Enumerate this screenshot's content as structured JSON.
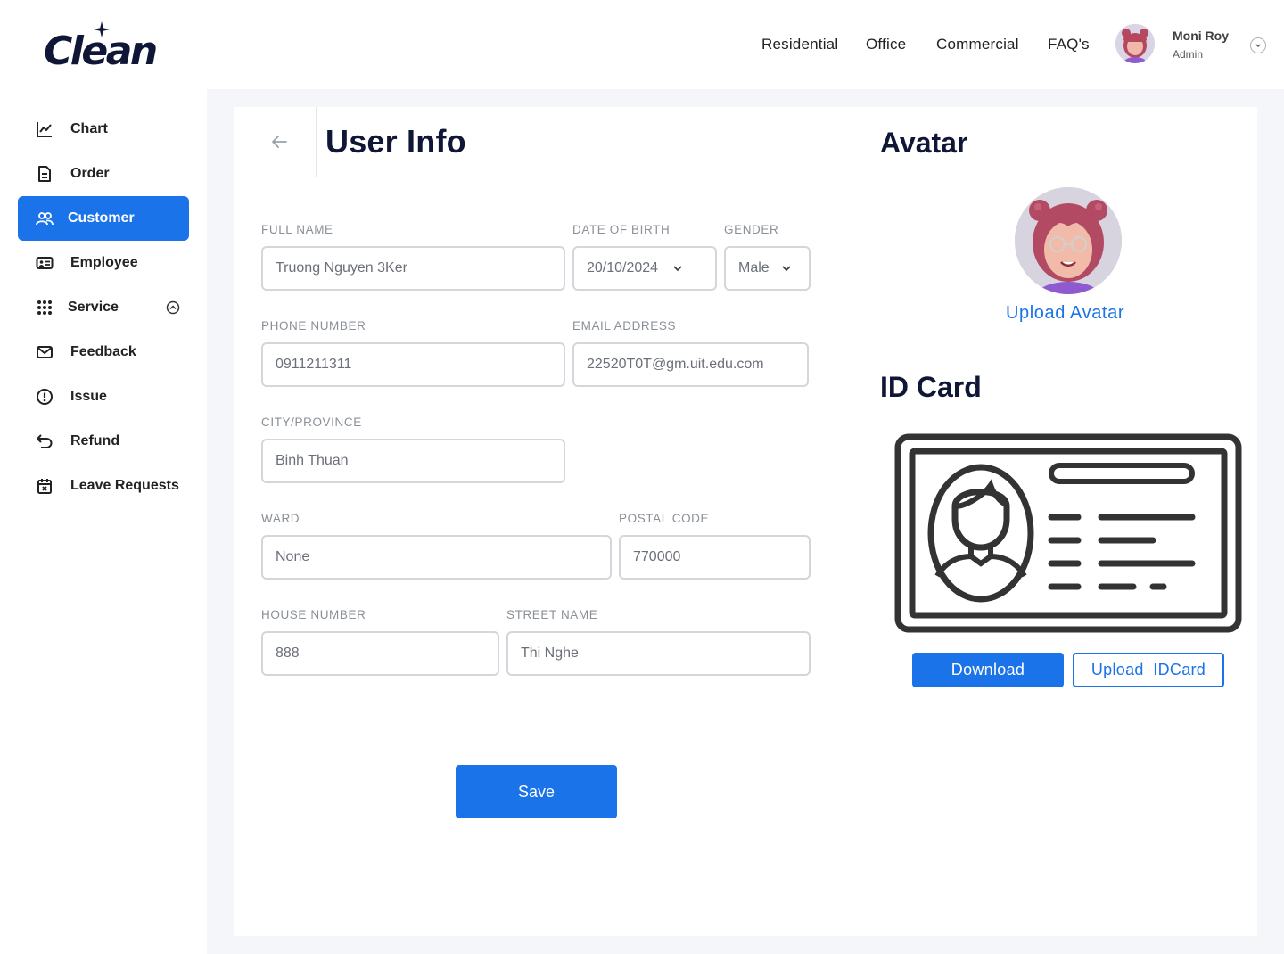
{
  "brand": {
    "logo_text": "Clean",
    "accent_color": "#1a73e8",
    "dark_color": "#0f1636"
  },
  "nav": {
    "residential": "Residential",
    "office": "Office",
    "commercial": "Commercial",
    "faq": "FAQ's"
  },
  "profile": {
    "name": "Moni Roy",
    "role": "Admin"
  },
  "sidebar": {
    "items": [
      {
        "label": "Chart",
        "icon": "line-chart-icon"
      },
      {
        "label": "Order",
        "icon": "document-icon"
      },
      {
        "label": "Customer",
        "icon": "users-icon",
        "active": true
      },
      {
        "label": "Employee",
        "icon": "id-badge-icon"
      },
      {
        "label": "Service",
        "icon": "grid-dots-icon"
      },
      {
        "label": "Feedback",
        "icon": "mail-icon"
      },
      {
        "label": "Issue",
        "icon": "alert-circle-icon"
      },
      {
        "label": "Refund",
        "icon": "undo-icon"
      },
      {
        "label": "Leave Requests",
        "icon": "calendar-x-icon"
      }
    ]
  },
  "form": {
    "title": "User Info",
    "full_name": {
      "label": "FULL NAME",
      "value": "Truong Nguyen 3Ker"
    },
    "dob": {
      "label": "DATE OF BIRTH",
      "value": "20/10/2024"
    },
    "gender": {
      "label": "GENDER",
      "value": "Male"
    },
    "phone": {
      "label": "PHONE NUMBER",
      "value": "0911211311"
    },
    "email": {
      "label": "EMAIL ADDRESS",
      "value": "22520T0T@gm.uit.edu.com"
    },
    "city": {
      "label": "CITY/PROVINCE",
      "value": "Binh Thuan"
    },
    "ward": {
      "label": "WARD",
      "value": "None"
    },
    "postal": {
      "label": "POSTAL CODE",
      "value": "770000"
    },
    "house": {
      "label": "HOUSE NUMBER",
      "value": "888"
    },
    "street": {
      "label": "STREET NAME",
      "value": "Thi Nghe"
    },
    "save_label": "Save"
  },
  "avatar_section": {
    "title": "Avatar",
    "upload_label": "Upload Avatar"
  },
  "idcard_section": {
    "title": "ID Card",
    "download_label": "Download",
    "upload_label": "Upload  IDCard"
  }
}
